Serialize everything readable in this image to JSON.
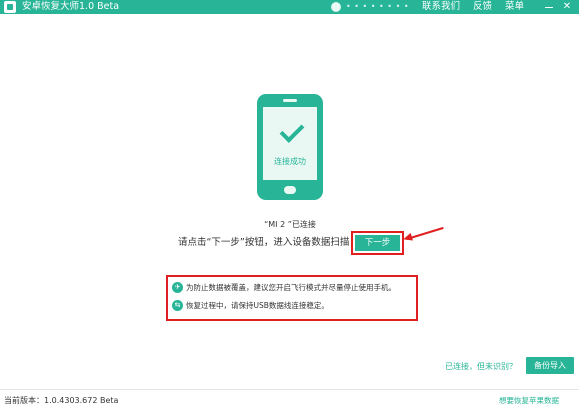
{
  "window": {
    "title": "安卓恢复大师1.0 Beta",
    "account_masked": "• • • • • • • •",
    "menu": {
      "contact": "联系我们",
      "feedback": "反馈",
      "menu": "菜单"
    },
    "close_glyph": "✕"
  },
  "phone": {
    "success_text": "连接成功"
  },
  "connection": {
    "device_status": "“MI 2 ”已连接",
    "instruction": "请点击“下一步”按钮，进入设备数据扫描",
    "next_button": "下一步"
  },
  "tips": [
    {
      "icon": "airplane-icon",
      "glyph": "✈",
      "text": "为防止数据被覆盖，建议您开启飞行模式并尽量停止使用手机。"
    },
    {
      "icon": "usb-icon",
      "glyph": "⇆",
      "text": "恢复过程中，请保持USB数据线连接稳定。"
    }
  ],
  "actions": {
    "connected_not_recognized": "已连接，但未识别？",
    "backup_import": "备份导入"
  },
  "footer": {
    "version": "当前版本：1.0.4303.672 Beta",
    "ios_link": "想要恢复苹果数据"
  },
  "colors": {
    "accent": "#27b497",
    "highlight_border": "#e02020"
  }
}
